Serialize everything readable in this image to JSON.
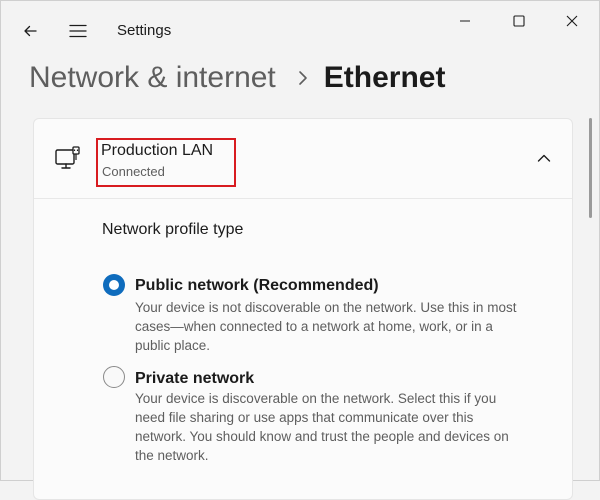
{
  "window": {
    "app_title": "Settings",
    "controls": [
      "minimize-icon",
      "maximize-icon",
      "close-icon"
    ]
  },
  "nav": {
    "back_icon": "back-arrow-icon",
    "menu_icon": "hamburger-menu-icon"
  },
  "breadcrumb": {
    "parent": "Network & internet",
    "separator_icon": "chevron-right-icon",
    "current": "Ethernet"
  },
  "connection": {
    "icon": "ethernet-monitor-icon",
    "name": "Production LAN",
    "status": "Connected",
    "expanded": true,
    "highlight_color": "#d81b20"
  },
  "profile": {
    "section_label": "Network profile type",
    "options": [
      {
        "title": "Public network (Recommended)",
        "description": "Your device is not discoverable on the network. Use this in most cases—when connected to a network at home, work, or in a public place.",
        "selected": true
      },
      {
        "title": "Private network",
        "description": "Your device is discoverable on the network. Select this if you need file sharing or use apps that communicate over this network. You should know and trust the people and devices on the network.",
        "selected": false
      }
    ]
  },
  "colors": {
    "accent": "#0f6cbd",
    "background": "#f3f3f3",
    "card": "#fbfbfb",
    "secondary_text": "#5e5e5e"
  }
}
